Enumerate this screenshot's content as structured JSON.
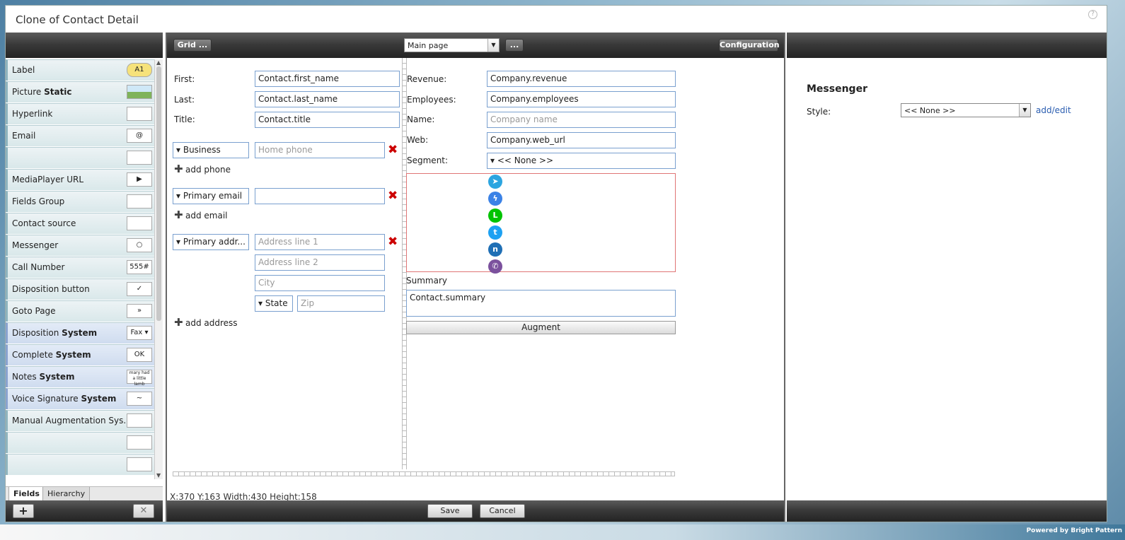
{
  "window": {
    "title": "Clone of Contact Detail",
    "help_icon": "question-icon"
  },
  "palette": {
    "items": [
      {
        "label": "Label",
        "bold": "",
        "icon": "A1"
      },
      {
        "label": "Picture ",
        "bold": "Static",
        "icon": ""
      },
      {
        "label": "Hyperlink",
        "bold": "",
        "icon": ""
      },
      {
        "label": "Email",
        "bold": "",
        "icon": "@"
      },
      {
        "label": "",
        "bold": "",
        "icon": ""
      },
      {
        "label": "MediaPlayer URL",
        "bold": "",
        "icon": "▶"
      },
      {
        "label": "Fields Group",
        "bold": "",
        "icon": ""
      },
      {
        "label": "Contact source",
        "bold": "",
        "icon": ""
      },
      {
        "label": "Messenger",
        "bold": "",
        "icon": "○"
      },
      {
        "label": "Call Number",
        "bold": "",
        "icon": "555#"
      },
      {
        "label": "Disposition button",
        "bold": "",
        "icon": "✓"
      },
      {
        "label": "Goto Page",
        "bold": "",
        "icon": "»"
      },
      {
        "label": "Disposition ",
        "bold": "System",
        "icon": "Fax ▾"
      },
      {
        "label": "Complete ",
        "bold": "System",
        "icon": "OK"
      },
      {
        "label": "Notes ",
        "bold": "System",
        "icon": "mary had a little lamb"
      },
      {
        "label": "Voice Signature ",
        "bold": "System",
        "icon": "~"
      },
      {
        "label": "Manual Augmentation Sys...",
        "bold": "",
        "icon": ""
      },
      {
        "label": "",
        "bold": "",
        "icon": ""
      },
      {
        "label": "",
        "bold": "",
        "icon": ""
      }
    ],
    "tabs": [
      "Fields",
      "Hierarchy"
    ],
    "add_button": "+",
    "delete_button": "✕"
  },
  "canvas": {
    "toolbar": {
      "grid": "Grid ...",
      "page": "Main page",
      "more": "...",
      "configuration": "Configuration"
    },
    "left_fields": [
      {
        "label": "First:",
        "value": "Contact.first_name"
      },
      {
        "label": "Last:",
        "value": "Contact.last_name"
      },
      {
        "label": "Title:",
        "value": "Contact.title"
      }
    ],
    "phone": {
      "type": "Business",
      "placeholder": "Home phone",
      "add": "add phone"
    },
    "email": {
      "type": "Primary email",
      "value": "",
      "add": "add email"
    },
    "address": {
      "type": "Primary addr...",
      "line1": "Address line 1",
      "line2": "Address line 2",
      "city": "City",
      "state": "State",
      "zip": "Zip",
      "add": "add address"
    },
    "right_fields": [
      {
        "label": "Revenue:",
        "value": "Company.revenue",
        "placeholder": false
      },
      {
        "label": "Employees:",
        "value": "Company.employees",
        "placeholder": false
      },
      {
        "label": "Name:",
        "value": "Company name",
        "placeholder": true
      },
      {
        "label": "Web:",
        "value": "Company.web_url",
        "placeholder": false
      }
    ],
    "segment": {
      "label": "Segment:",
      "value": "<< None >>"
    },
    "messengers": [
      {
        "name": "telegram-icon",
        "color": "#2ca5e0",
        "glyph": "➤"
      },
      {
        "name": "messenger-icon",
        "color": "#3b82e6",
        "glyph": "ϟ"
      },
      {
        "name": "line-icon",
        "color": "#00c300",
        "glyph": "L"
      },
      {
        "name": "twitter-icon",
        "color": "#1da1f2",
        "glyph": "t"
      },
      {
        "name": "nice-icon",
        "color": "#1f6fb5",
        "glyph": "n"
      },
      {
        "name": "viber-icon",
        "color": "#7b519d",
        "glyph": "✆"
      }
    ],
    "summary": {
      "label": "Summary",
      "value": "Contact.summary"
    },
    "augment": "Augment",
    "status": "X:370 Y:163 Width:430 Height:158",
    "save": "Save",
    "cancel": "Cancel"
  },
  "properties": {
    "heading": "Messenger",
    "style_label": "Style:",
    "style_value": "<< None >>",
    "add_edit": "add/edit"
  },
  "footer": {
    "powered": "Powered by Bright Pattern"
  }
}
